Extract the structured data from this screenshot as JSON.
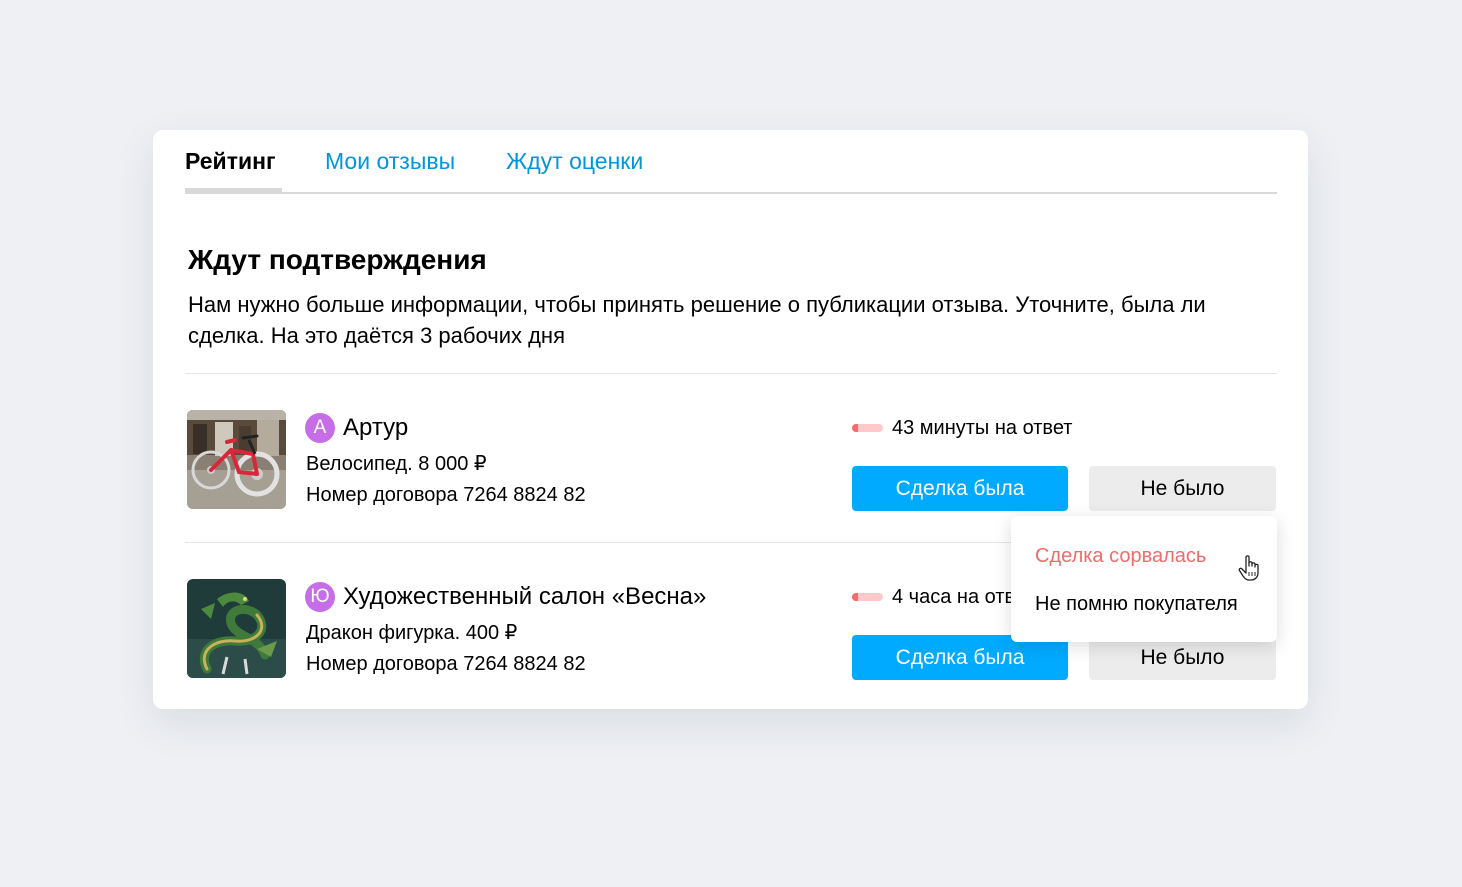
{
  "tabs": [
    {
      "label": "Рейтинг",
      "active": true
    },
    {
      "label": "Мои отзывы",
      "active": false
    },
    {
      "label": "Ждут оценки",
      "active": false
    }
  ],
  "section": {
    "title": "Ждут подтверждения",
    "description": "Нам нужно больше информации, чтобы принять решение о публикации отзыва. Уточните, была ли сделка. На это даётся 3 рабочих дня"
  },
  "deals": [
    {
      "avatar_letter": "А",
      "seller": "Артур",
      "item": "Велосипед. 8 000 ₽",
      "contract": "Номер договора 7264 8824 82",
      "time_left": "43 минуты на ответ",
      "time_left_fraction": 0.2,
      "yes_label": "Сделка была",
      "no_label": "Не было",
      "image": "bicycle-photo"
    },
    {
      "avatar_letter": "Ю",
      "seller": "Художественный салон «Весна»",
      "item": "Дракон фигурка. 400 ₽",
      "contract": "Номер договора 7264 8824 82",
      "time_left": "4 часа на ответ",
      "time_left_fraction": 0.2,
      "yes_label": "Сделка была",
      "no_label": "Не было",
      "image": "dragon-figurine-photo"
    }
  ],
  "dropdown": {
    "items": [
      {
        "label": "Сделка сорвалась",
        "color": "#f26b6b"
      },
      {
        "label": "Не помню покупателя",
        "color": "#000000"
      }
    ]
  },
  "colors": {
    "accent": "#00aaff",
    "link": "#0096dc",
    "avatar": "#c56ee8",
    "timer": "#f56c6c",
    "danger": "#f26b6b"
  }
}
